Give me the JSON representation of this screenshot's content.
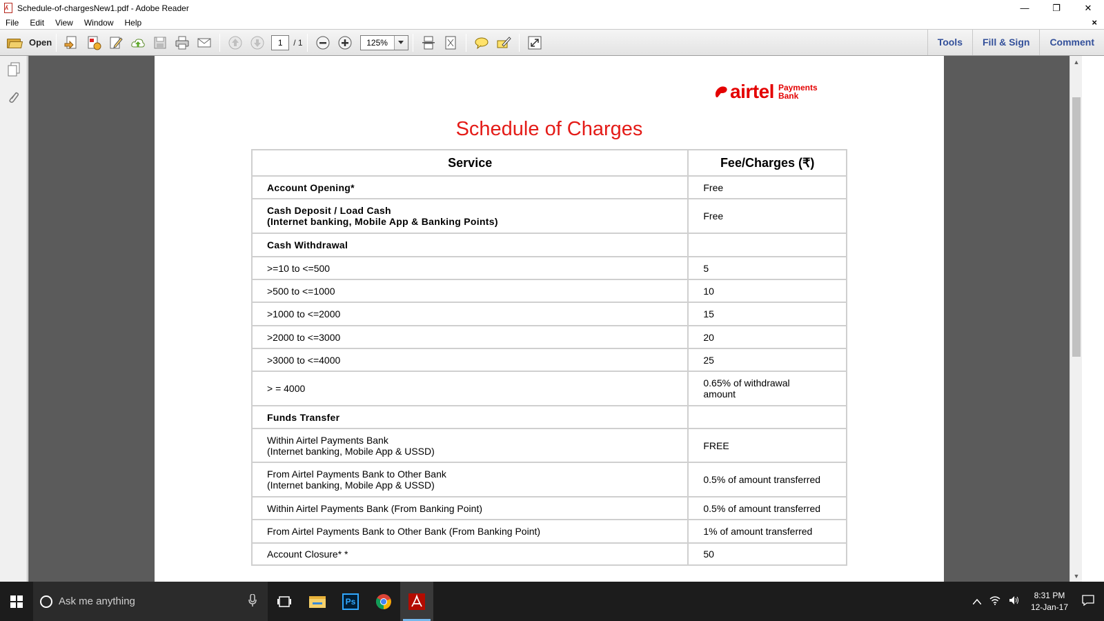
{
  "window": {
    "title": "Schedule-of-chargesNew1.pdf - Adobe Reader",
    "controls": {
      "minimize": "—",
      "restore": "❐",
      "close": "✕"
    }
  },
  "menu": {
    "items": [
      "File",
      "Edit",
      "View",
      "Window",
      "Help"
    ],
    "close_doc": "×"
  },
  "toolbar": {
    "open_label": "Open",
    "page_current": "1",
    "page_total": "/ 1",
    "zoom_value": "125%",
    "right_buttons": [
      "Tools",
      "Fill & Sign",
      "Comment"
    ]
  },
  "document": {
    "logo": {
      "word": "airtel",
      "sub_line1": "Payments",
      "sub_line2": "Bank"
    },
    "title": "Schedule of Charges",
    "table": {
      "headers": [
        "Service",
        "Fee/Charges (₹)"
      ],
      "rows": [
        {
          "service": "Account Opening*",
          "service2": "",
          "fee": "Free",
          "fee2": "",
          "bold": true
        },
        {
          "service": "Cash Deposit / Load Cash",
          "service2": "(Internet banking, Mobile App & Banking Points)",
          "fee": "Free",
          "fee2": "",
          "bold": true
        },
        {
          "service": "Cash Withdrawal",
          "service2": "",
          "fee": "",
          "fee2": "",
          "bold": true
        },
        {
          "service": ">=10 to <=500",
          "service2": "",
          "fee": "5",
          "fee2": "",
          "bold": false
        },
        {
          "service": ">500 to <=1000",
          "service2": "",
          "fee": "10",
          "fee2": "",
          "bold": false
        },
        {
          "service": ">1000 to <=2000",
          "service2": "",
          "fee": "15",
          "fee2": "",
          "bold": false
        },
        {
          "service": ">2000 to <=3000",
          "service2": "",
          "fee": "20",
          "fee2": "",
          "bold": false
        },
        {
          "service": ">3000 to <=4000",
          "service2": "",
          "fee": "25",
          "fee2": "",
          "bold": false
        },
        {
          "service": "> = 4000",
          "service2": "",
          "fee": "0.65% of withdrawal",
          "fee2": "amount",
          "bold": false
        },
        {
          "service": "Funds Transfer",
          "service2": "",
          "fee": "",
          "fee2": "",
          "bold": true
        },
        {
          "service": "Within Airtel Payments Bank",
          "service2": "(Internet banking, Mobile App & USSD)",
          "fee": "FREE",
          "fee2": "",
          "bold": false
        },
        {
          "service": "From Airtel Payments Bank to Other Bank",
          "service2": "(Internet banking, Mobile App & USSD)",
          "fee": "0.5% of amount transferred",
          "fee2": "",
          "bold": false
        },
        {
          "service": "Within Airtel Payments Bank (From Banking Point)",
          "service2": "",
          "fee": "0.5% of amount transferred",
          "fee2": "",
          "bold": false
        },
        {
          "service": "From Airtel Payments Bank to Other Bank (From Banking Point)",
          "service2": "",
          "fee": "1% of amount transferred",
          "fee2": "",
          "bold": false
        },
        {
          "service": "Account Closure* *",
          "service2": "",
          "fee": "50",
          "fee2": "",
          "bold": false
        }
      ]
    }
  },
  "taskbar": {
    "search_placeholder": "Ask me anything",
    "clock_time": "8:31 PM",
    "clock_date": "12-Jan-17",
    "apps": [
      "file-explorer-icon",
      "photoshop-icon",
      "chrome-icon",
      "adobe-reader-icon"
    ],
    "photoshop_label": "Ps"
  },
  "colors": {
    "airtel_red": "#e40000",
    "title_red": "#e41b17",
    "toolbar_link": "#33509a",
    "doc_bg": "#5b5b5b",
    "taskbar_bg": "#1c1c1c"
  }
}
